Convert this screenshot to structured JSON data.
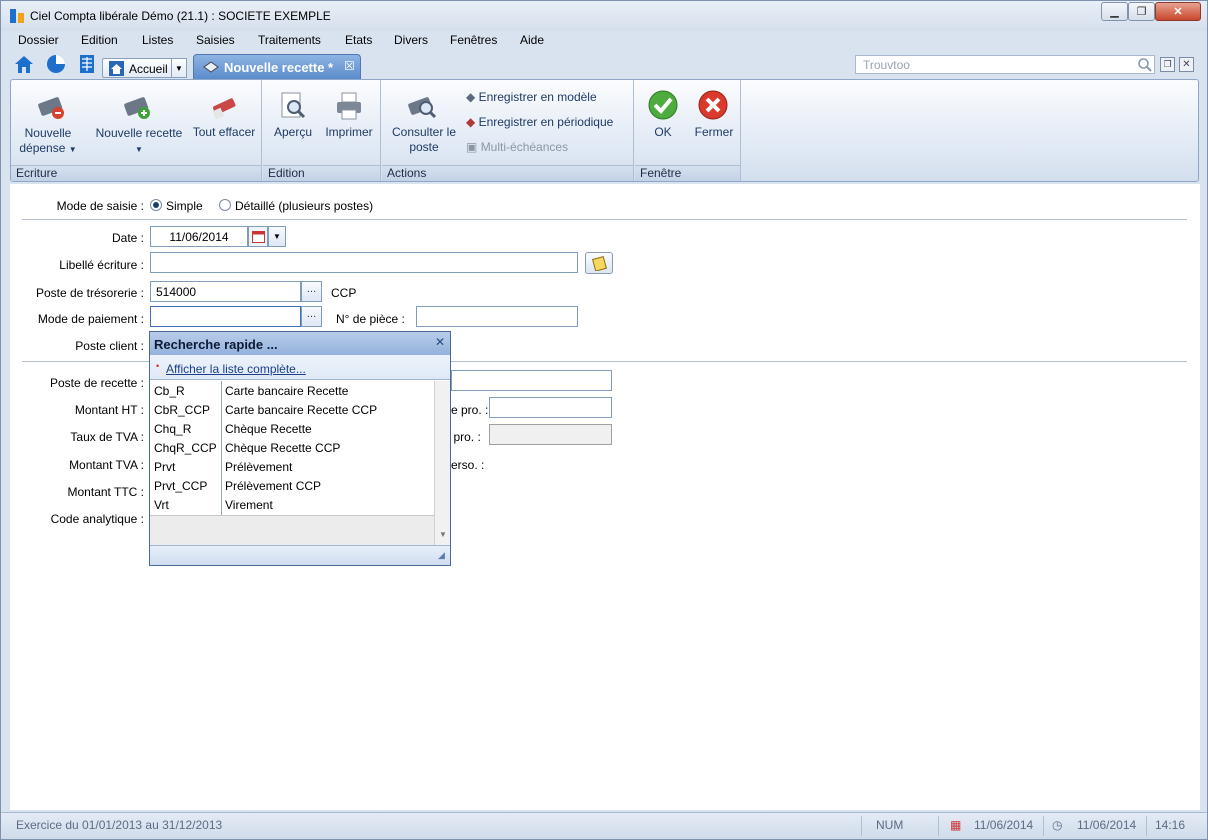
{
  "window": {
    "title": "Ciel Compta libérale Démo (21.1) : SOCIETE EXEMPLE"
  },
  "menu": [
    "Dossier",
    "Edition",
    "Listes",
    "Saisies",
    "Traitements",
    "Etats",
    "Divers",
    "Fenêtres",
    "Aide"
  ],
  "tabs": {
    "home": "Accueil",
    "active": "Nouvelle recette *"
  },
  "search": {
    "placeholder": "Trouvtoo"
  },
  "ribbon": {
    "ecriture": {
      "label": "Ecriture",
      "new_expense": "Nouvelle\ndépense",
      "new_receipt": "Nouvelle recette",
      "clear_all": "Tout effacer"
    },
    "edition": {
      "label": "Edition",
      "preview": "Aperçu",
      "print": "Imprimer"
    },
    "actions": {
      "label": "Actions",
      "consult": "Consulter le\nposte",
      "save_model": "Enregistrer en modèle",
      "save_periodic": "Enregistrer en périodique",
      "multi": "Multi-échéances"
    },
    "fenetre": {
      "label": "Fenêtre",
      "ok": "OK",
      "close": "Fermer"
    }
  },
  "form": {
    "mode_label": "Mode de saisie :",
    "mode_simple": "Simple",
    "mode_detail": "Détaillé (plusieurs postes)",
    "mode_selected": "Simple",
    "date_label": "Date :",
    "date_value": "11/06/2014",
    "libelle_label": "Libellé écriture :",
    "libelle_value": "",
    "poste_tresorerie_label": "Poste de trésorerie :",
    "poste_tresorerie_value": "514000",
    "poste_tresorerie_name": "CCP",
    "mode_paiement_label": "Mode de paiement :",
    "mode_paiement_value": "",
    "piece_label": "N° de pièce :",
    "piece_value": "",
    "poste_client_label": "Poste client :",
    "poste_recette_label": "Poste de recette :",
    "montant_ht_label": "Montant HT :",
    "taux_tva_label": "Taux de TVA :",
    "montant_tva_label": "Montant TVA :",
    "montant_ttc_label": "Montant TTC :",
    "code_analytique_label": "Code analytique :",
    "right_pro_label": "e pro. :",
    "right_t_pro_label": "T pro. :",
    "right_perso_label": "erso. :"
  },
  "popup": {
    "title": "Recherche rapide ...",
    "link": "Afficher la liste complète...",
    "rows": [
      {
        "code": "Cb_R",
        "label": "Carte bancaire Recette"
      },
      {
        "code": "CbR_CCP",
        "label": "Carte bancaire Recette CCP"
      },
      {
        "code": "Chq_R",
        "label": "Chèque Recette"
      },
      {
        "code": "ChqR_CCP",
        "label": "Chèque Recette CCP"
      },
      {
        "code": "Prvt",
        "label": "Prélèvement"
      },
      {
        "code": "Prvt_CCP",
        "label": "Prélèvement CCP"
      },
      {
        "code": "Vrt",
        "label": "Virement"
      }
    ]
  },
  "status": {
    "exercice": "Exercice du 01/01/2013 au 31/12/2013",
    "num": "NUM",
    "date1": "11/06/2014",
    "date2": "11/06/2014",
    "time": "14:16"
  }
}
